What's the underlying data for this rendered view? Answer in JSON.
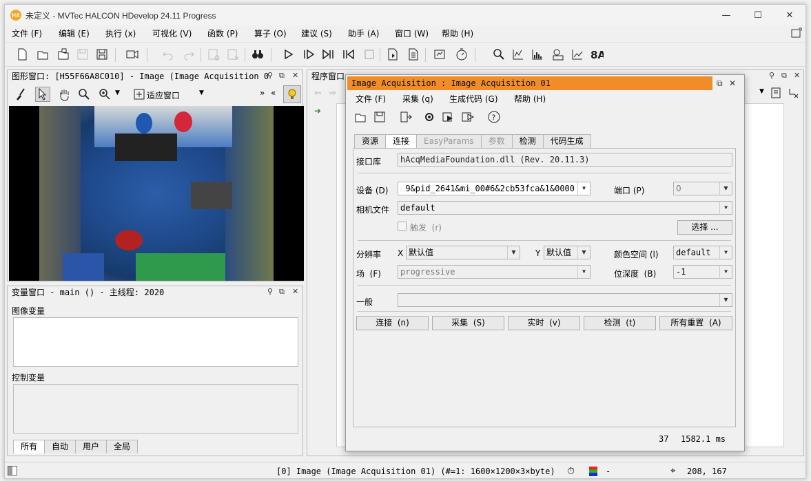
{
  "window": {
    "logo_text": "HA",
    "title": "未定义 - MVTec HALCON HDevelop 24.11 Progress",
    "minimize": "—",
    "maximize": "☐",
    "close": "✕"
  },
  "menu": [
    {
      "label": "文件",
      "key": "(F)"
    },
    {
      "label": "编辑",
      "key": "(E)"
    },
    {
      "label": "执行",
      "key": "(x)"
    },
    {
      "label": "可视化",
      "key": "(V)"
    },
    {
      "label": "函数",
      "key": "(P)"
    },
    {
      "label": "算子",
      "key": "(O)"
    },
    {
      "label": "建议",
      "key": "(S)"
    },
    {
      "label": "助手",
      "key": "(A)"
    },
    {
      "label": "窗口",
      "key": "(W)"
    },
    {
      "label": "帮助",
      "key": "(H)"
    }
  ],
  "graphics_window": {
    "title": "图形窗口: [H55F66A8C010] - Image (Image Acquisition 0",
    "fit_label": "适应窗口"
  },
  "variable_window": {
    "title": "变量窗口 - main () - 主线程: 2020",
    "image_vars_label": "图像变量",
    "control_vars_label": "控制变量",
    "tabs": [
      "所有",
      "自动",
      "用户",
      "全局"
    ]
  },
  "program_window": {
    "title": "程序窗口"
  },
  "dialog": {
    "title": "Image Acquisition : Image Acquisition 01",
    "menu": [
      {
        "label": "文件",
        "key": "(F)"
      },
      {
        "label": "采集",
        "key": "(q)"
      },
      {
        "label": "生成代码",
        "key": "(G)"
      },
      {
        "label": "帮助",
        "key": "(H)"
      }
    ],
    "tabs": [
      "资源",
      "连接",
      "EasyParams",
      "参数",
      "检测",
      "代码生成"
    ],
    "active_tab": "连接",
    "interface_label": "接口库",
    "interface_value": "hAcqMediaFoundation.dll (Rev. 20.11.3)",
    "device_label": "设备",
    "device_key": "(D)",
    "device_value": "9&pid_2641&mi_00#6&2cb53fca&1&0000",
    "port_label": "端口",
    "port_key": "(P)",
    "port_value": "0",
    "camera_file_label": "相机文件",
    "camera_file_value": "default",
    "trigger_label": "触发",
    "trigger_key": "(r)",
    "select_button": "选择 ...",
    "resolution_label": "分辨率",
    "x_label": "X",
    "x_value": "默认值",
    "y_label": "Y",
    "y_value": "默认值",
    "colorspace_label": "颜色空间",
    "colorspace_key": "(l)",
    "colorspace_value": "default",
    "field_label": "场",
    "field_key": "(F)",
    "field_value": "progressive",
    "bitdepth_label": "位深度",
    "bitdepth_key": "(B)",
    "bitdepth_value": "-1",
    "general_label": "一般",
    "general_value": "",
    "buttons": [
      {
        "label": "连接",
        "key": "(n)"
      },
      {
        "label": "采集",
        "key": "(S)"
      },
      {
        "label": "实时",
        "key": "(v)"
      },
      {
        "label": "检测",
        "key": "(t)"
      },
      {
        "label": "所有重置",
        "key": "(A)"
      }
    ],
    "status_count": "37",
    "status_time": "1582.1 ms"
  },
  "statusbar": {
    "info": "[0] Image (Image Acquisition 01) (#=1: 1600×1200×3×byte)",
    "dash": "-",
    "coords": "208, 167"
  }
}
